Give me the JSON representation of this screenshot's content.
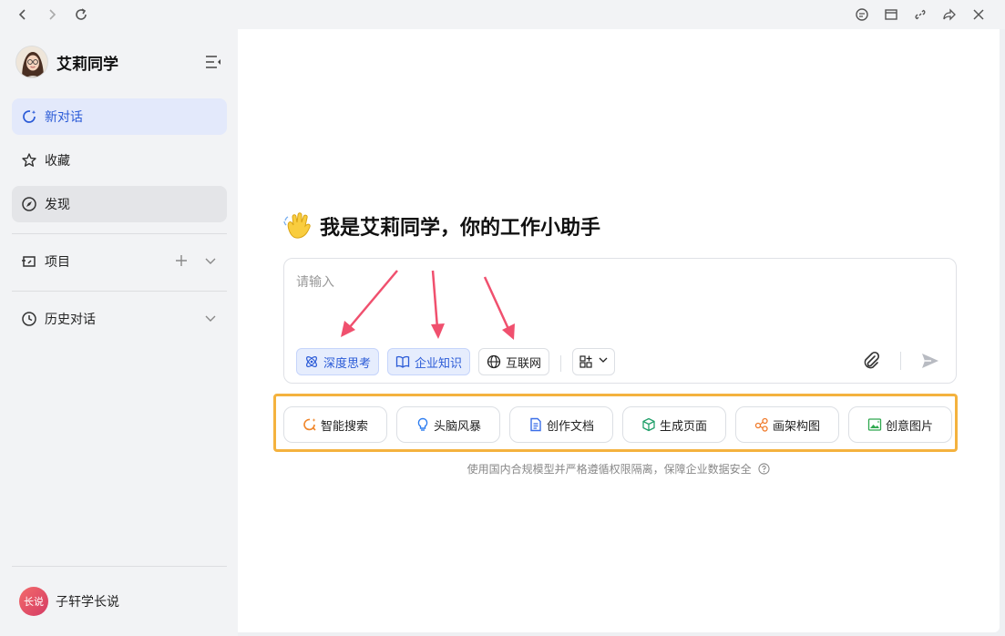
{
  "window": {
    "icons": [
      "back-icon",
      "forward-icon",
      "refresh-icon",
      "chat-icon",
      "window-icon",
      "link-icon",
      "share-icon",
      "close-icon"
    ]
  },
  "sidebar": {
    "brand_name": "艾莉同学",
    "items": [
      {
        "label": "新对话",
        "icon": "new-chat-icon"
      },
      {
        "label": "收藏",
        "icon": "star-icon"
      },
      {
        "label": "发现",
        "icon": "compass-icon"
      },
      {
        "label": "项目",
        "icon": "project-icon"
      },
      {
        "label": "历史对话",
        "icon": "clock-icon"
      }
    ],
    "user": {
      "avatar_text": "长说",
      "name": "子轩学长说"
    }
  },
  "main": {
    "greeting": "我是艾莉同学，你的工作小助手",
    "input_placeholder": "请输入",
    "chips": [
      {
        "label": "深度思考",
        "active": true
      },
      {
        "label": "企业知识",
        "active": true
      },
      {
        "label": "互联网",
        "active": false
      }
    ],
    "suggestions": [
      {
        "label": "智能搜索",
        "color": "#f0862a"
      },
      {
        "label": "头脑风暴",
        "color": "#2b7cf0"
      },
      {
        "label": "创作文档",
        "color": "#3a6ee8"
      },
      {
        "label": "生成页面",
        "color": "#22a06b"
      },
      {
        "label": "画架构图",
        "color": "#f07a2a"
      },
      {
        "label": "创意图片",
        "color": "#2fa84f"
      }
    ],
    "footnote": "使用国内合规模型并严格遵循权限隔离，保障企业数据安全"
  },
  "colors": {
    "accent": "#2b5bd7",
    "highlight_frame": "#f4b23e",
    "annotation_arrow": "#f0506e"
  }
}
